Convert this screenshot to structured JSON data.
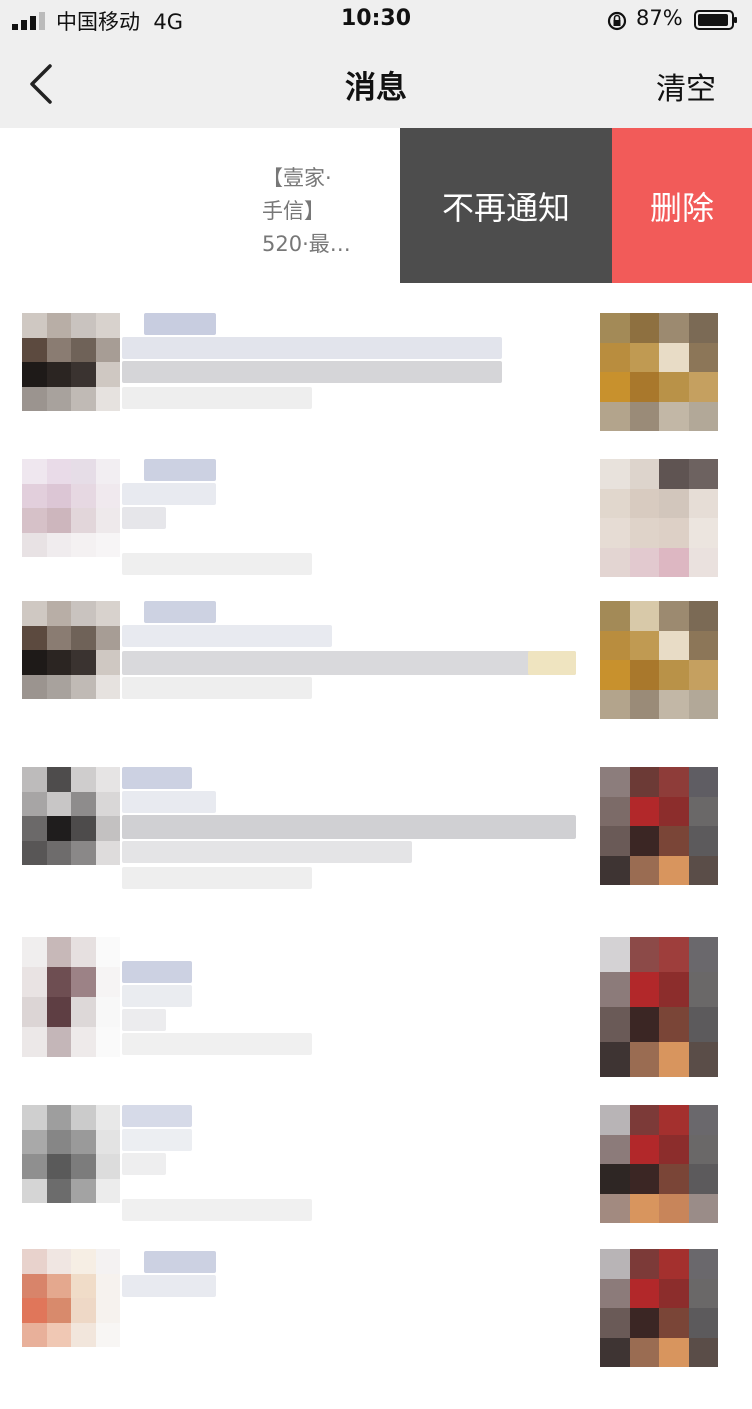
{
  "status_bar": {
    "carrier": "中国移动",
    "network": "4G",
    "time": "10:30",
    "battery": "87%"
  },
  "nav": {
    "title": "消息",
    "clear_label": "清空"
  },
  "swipe_row": {
    "preview_lines": [
      "【壹家·",
      "手信】",
      "520·最…"
    ],
    "mute_label": "不再通知",
    "delete_label": "删除"
  }
}
